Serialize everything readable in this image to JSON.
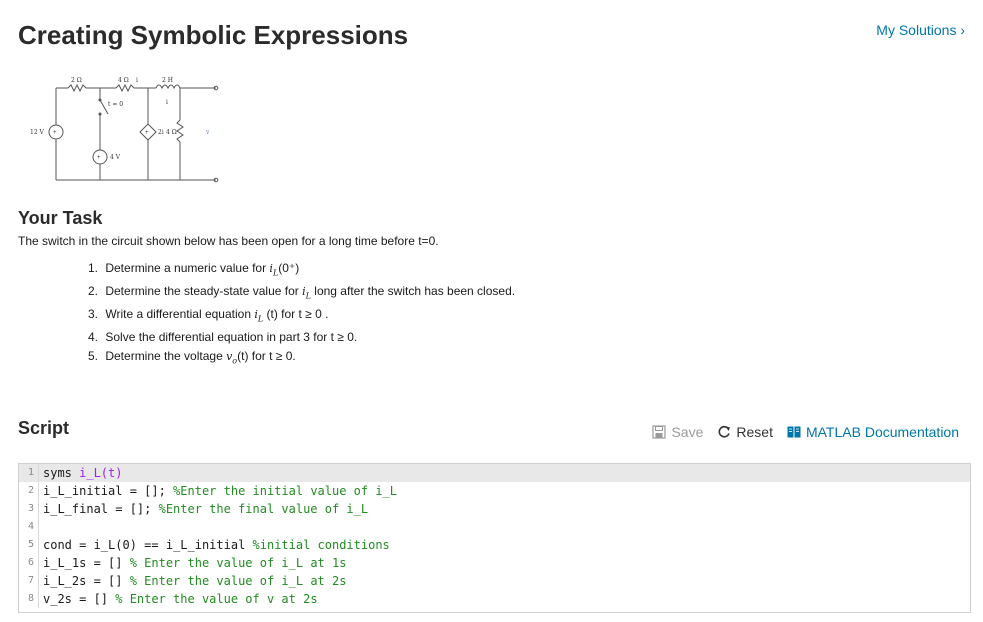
{
  "page": {
    "title": "Creating Symbolic Expressions",
    "my_solutions": "My Solutions ›"
  },
  "circuit": {
    "r1": "2 Ω",
    "r2": "4 Ω",
    "il_top": "i",
    "inductor": "2 H",
    "il_mid": "i",
    "switch": "t = 0",
    "source_v": "12 V",
    "dep_source": "2i",
    "r3": "4 Ω",
    "vo": "v",
    "source_4v": "4 V"
  },
  "task": {
    "heading": "Your Task",
    "intro": "The switch in the circuit shown below has been open for a long time before t=0.",
    "items": [
      {
        "n": "1.",
        "pre": "Determine a numeric value for ",
        "math": "i",
        "sub": "L",
        "post_math": "(0⁺)",
        "post": ""
      },
      {
        "n": "2.",
        "pre": "Determine the steady-state value for ",
        "math": "i",
        "sub": "L",
        "post_math": "",
        "post": " long after the switch has been closed."
      },
      {
        "n": "3.",
        "pre": "Write a differential equation ",
        "math": "i",
        "sub": "L",
        "post_math": "",
        "post": " (t) for t ≥ 0 ."
      },
      {
        "n": "4.",
        "pre": "Solve the differential equation in part 3 for t ≥ 0.",
        "math": "",
        "sub": "",
        "post_math": "",
        "post": ""
      },
      {
        "n": "5.",
        "pre": "Determine the voltage ",
        "math": "v",
        "sub": "o",
        "post_math": "",
        "post": "(t)  for t ≥ 0."
      }
    ]
  },
  "script": {
    "heading": "Script",
    "save": "Save",
    "reset": "Reset",
    "docs": "MATLAB Documentation",
    "lines": [
      {
        "n": "1",
        "code": "syms ",
        "fn": "i_L(t)",
        "comment": ""
      },
      {
        "n": "2",
        "code": "i_L_initial = []; ",
        "fn": "",
        "comment": "%Enter the initial value of i_L"
      },
      {
        "n": "3",
        "code": "i_L_final = []; ",
        "fn": "",
        "comment": "%Enter the final value of i_L"
      },
      {
        "n": "4",
        "code": "",
        "fn": "",
        "comment": ""
      },
      {
        "n": "5",
        "code": "cond = i_L(0) == i_L_initial ",
        "fn": "",
        "comment": "%initial conditions"
      },
      {
        "n": "6",
        "code": "i_L_1s = [] ",
        "fn": "",
        "comment": "% Enter the value of i_L at 1s"
      },
      {
        "n": "7",
        "code": "i_L_2s = [] ",
        "fn": "",
        "comment": "% Enter the value of i_L at 2s"
      },
      {
        "n": "8",
        "code": "v_2s = [] ",
        "fn": "",
        "comment": "% Enter the value of v at 2s"
      }
    ]
  },
  "colors": {
    "link": "#0076a8",
    "comment": "#228b22",
    "function": "#a020f0"
  }
}
